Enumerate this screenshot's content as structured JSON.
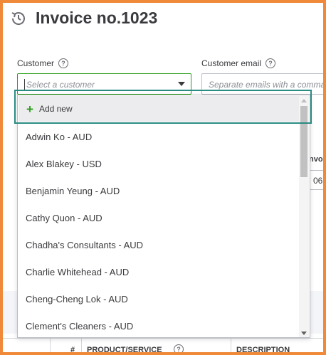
{
  "header": {
    "title": "Invoice no.1023",
    "icon": "clock-icon"
  },
  "customer": {
    "label": "Customer",
    "placeholder": "Select a customer"
  },
  "customer_email": {
    "label": "Customer email",
    "placeholder": "Separate emails with a comma"
  },
  "dropdown": {
    "add_new_label": "Add new",
    "options": [
      "Adwin Ko - AUD",
      "Alex Blakey - USD",
      "Benjamin Yeung - AUD",
      "Cathy Quon - AUD",
      "Chadha's Consultants - AUD",
      "Charlie Whitehead - AUD",
      "Cheng-Cheng Lok - AUD",
      "Clement's Cleaners - AUD"
    ]
  },
  "background": {
    "invoice_label_partial": "Invo",
    "invoice_value_partial": "06"
  },
  "table": {
    "col_num": "#",
    "col_product": "PRODUCT/SERVICE",
    "col_description": "DESCRIPTION"
  },
  "colors": {
    "accent_green": "#2ca01c",
    "frame_orange": "#f08a3a",
    "highlight_teal": "#2b8c84"
  }
}
